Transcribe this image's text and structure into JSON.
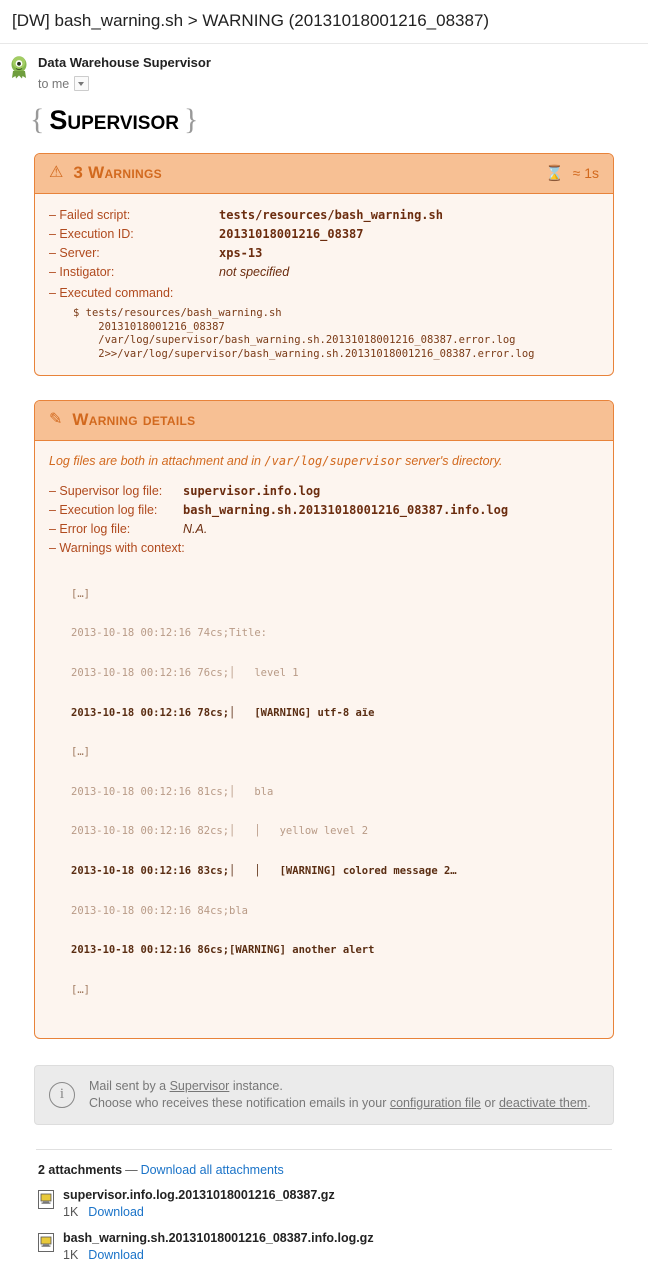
{
  "mail": {
    "subject": "[DW] bash_warning.sh > WARNING (20131018001216_08387)",
    "sender_name": "Data Warehouse Supervisor",
    "to_line": "to me",
    "avatar_icon": "monster-avatar-icon",
    "caret_icon": "chevron-down-icon"
  },
  "logo": {
    "left_brace": "{",
    "word": "Supervisor",
    "right_brace": "}"
  },
  "warning_panel": {
    "icon": "warning-triangle-icon",
    "title": "3 Warnings",
    "duration_icon": "hourglass-icon",
    "duration": "≈ 1s",
    "rows": [
      {
        "key": "– Failed script:",
        "value": "tests/resources/bash_warning.sh",
        "italic": false
      },
      {
        "key": "– Execution ID:",
        "value": "20131018001216_08387",
        "italic": false
      },
      {
        "key": "– Server:",
        "value": "xps-13",
        "italic": false
      },
      {
        "key": "– Instigator:",
        "value": "not specified",
        "italic": true
      }
    ],
    "command_label": "– Executed command:",
    "command_lines": [
      "$ tests/resources/bash_warning.sh",
      "    20131018001216_08387",
      "    /var/log/supervisor/bash_warning.sh.20131018001216_08387.error.log",
      "    2>>/var/log/supervisor/bash_warning.sh.20131018001216_08387.error.log"
    ]
  },
  "details_panel": {
    "icon": "paperclip-icon",
    "title": "Warning details",
    "note_prefix": "Log files are both in attachment and in ",
    "note_path": "/var/log/supervisor",
    "note_suffix": " server's directory.",
    "rows": [
      {
        "key": "– Supervisor log file:",
        "value": "supervisor.info.log",
        "italic": false
      },
      {
        "key": "– Execution log file:",
        "value": "bash_warning.sh.20131018001216_08387.info.log",
        "italic": false
      },
      {
        "key": "– Error log file:",
        "value": "N.A.",
        "italic": true
      }
    ],
    "context_label": "– Warnings with context:",
    "context_lines": [
      {
        "text": "[…]",
        "style": "mid"
      },
      {
        "text": "2013-10-18 00:12:16 74cs;Title:",
        "style": "normal"
      },
      {
        "text": "2013-10-18 00:12:16 76cs;│   level 1",
        "style": "normal"
      },
      {
        "text": "2013-10-18 00:12:16 78cs;│   [WARNING] utf-8 aïe",
        "style": "bold"
      },
      {
        "text": "[…]",
        "style": "mid"
      },
      {
        "text": "2013-10-18 00:12:16 81cs;│   bla",
        "style": "normal"
      },
      {
        "text": "2013-10-18 00:12:16 82cs;│   │   yellow level 2",
        "style": "normal"
      },
      {
        "text": "2013-10-18 00:12:16 83cs;│   │   [WARNING] colored message 2…",
        "style": "bold"
      },
      {
        "text": "2013-10-18 00:12:16 84cs;bla",
        "style": "normal"
      },
      {
        "text": "2013-10-18 00:12:16 86cs;[WARNING] another alert",
        "style": "bold"
      },
      {
        "text": "[…]",
        "style": "mid"
      }
    ]
  },
  "info_box": {
    "icon": "info-circle-icon",
    "line1_a": "Mail sent by a ",
    "line1_link": "Supervisor",
    "line1_b": " instance.",
    "line2_a": "Choose who receives these notification emails in your ",
    "line2_link1": "configuration file",
    "line2_b": " or ",
    "line2_link2": "deactivate them",
    "line2_c": "."
  },
  "attachments": {
    "count_label": "2 attachments",
    "dash": "—",
    "download_all": "Download all attachments",
    "items": [
      {
        "icon": "file-gz-icon",
        "name": "supervisor.info.log.20131018001216_08387.gz",
        "size": "1K",
        "download": "Download"
      },
      {
        "icon": "file-gz-icon",
        "name": "bash_warning.sh.20131018001216_08387.info.log.gz",
        "size": "1K",
        "download": "Download"
      }
    ]
  },
  "colors": {
    "accent_orange": "#d2691e",
    "panel_header": "#f7c094",
    "panel_border": "#e8833a",
    "panel_body": "#fdf5ef",
    "link_blue": "#1a73c8"
  }
}
